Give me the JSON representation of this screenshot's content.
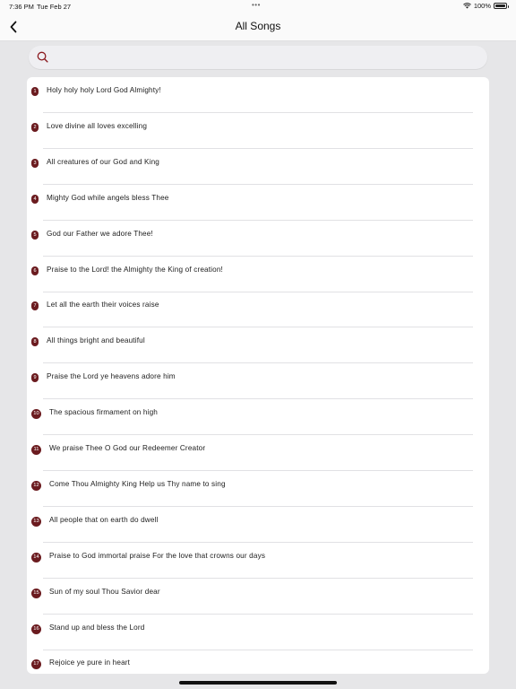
{
  "status_bar": {
    "time": "7:36 PM",
    "date": "Tue Feb 27",
    "multitask_dots": "•••",
    "battery": "100%",
    "icons": [
      "wifi-icon",
      "battery-icon"
    ]
  },
  "nav": {
    "title": "All Songs",
    "back_icon": "chevron-left-icon"
  },
  "search": {
    "icon": "search-icon",
    "value": "",
    "accent_color": "#8b1a1f"
  },
  "colors": {
    "badge": "#6b1b1f",
    "background": "#e6e6e8",
    "list_background": "#ffffff"
  },
  "songs": [
    {
      "number": "1",
      "title": "Holy holy holy Lord God Almighty!"
    },
    {
      "number": "2",
      "title": "Love divine all loves excelling"
    },
    {
      "number": "3",
      "title": "All creatures of our God and King"
    },
    {
      "number": "4",
      "title": "Mighty God while angels bless Thee"
    },
    {
      "number": "5",
      "title": "God our Father we adore Thee!"
    },
    {
      "number": "6",
      "title": "Praise to the Lord! the Almighty the King of creation!"
    },
    {
      "number": "7",
      "title": "Let all the earth their voices raise"
    },
    {
      "number": "8",
      "title": "All things bright and beautiful"
    },
    {
      "number": "9",
      "title": "Praise the Lord ye heavens adore him"
    },
    {
      "number": "10",
      "title": "The spacious firmament on high"
    },
    {
      "number": "11",
      "title": "We praise Thee O God our Redeemer Creator"
    },
    {
      "number": "12",
      "title": "Come Thou Almighty King Help us Thy name to sing"
    },
    {
      "number": "13",
      "title": "All people that on earth do dwell"
    },
    {
      "number": "14",
      "title": "Praise to God immortal praise For the love that crowns our days"
    },
    {
      "number": "15",
      "title": "Sun of my soul Thou Savior dear"
    },
    {
      "number": "16",
      "title": "Stand up and bless the Lord"
    },
    {
      "number": "17",
      "title": "Rejoice ye pure in heart"
    }
  ]
}
